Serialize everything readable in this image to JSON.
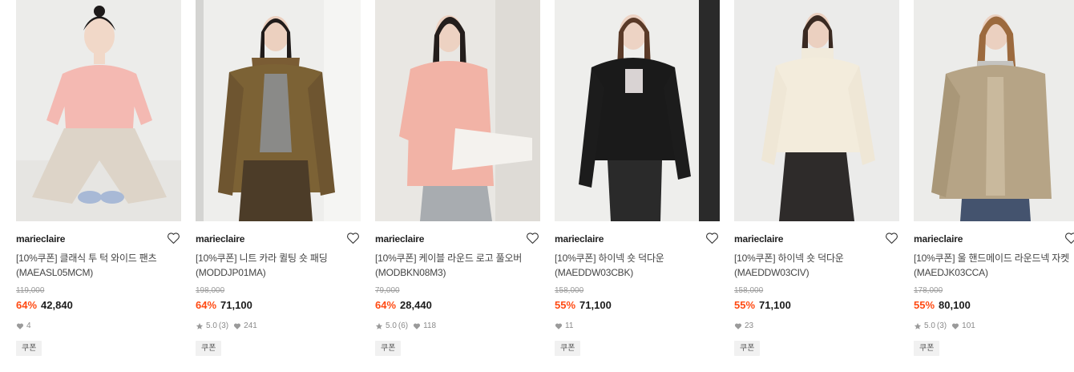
{
  "products": [
    {
      "brand": "marieclaire",
      "name": "[10%쿠폰] 클래식 투 턱 와이드 팬츠 (MAEASL05MCM)",
      "original_price": "119,000",
      "discount": "64%",
      "price": "42,840",
      "rating": "",
      "review_count": "",
      "likes": "4",
      "badge": "쿠폰",
      "image": "model-pink-knit-wide-pants"
    },
    {
      "brand": "marieclaire",
      "name": "[10%쿠폰] 니트 카라 퀼팅 숏 패딩 (MODDJP01MA)",
      "original_price": "198,000",
      "discount": "64%",
      "price": "71,100",
      "rating": "5.0",
      "review_count": "(3)",
      "likes": "241",
      "badge": "쿠폰",
      "image": "model-khaki-quilted-padding"
    },
    {
      "brand": "marieclaire",
      "name": "[10%쿠폰] 케이블 라운드 로고 풀오버 (MODBKN08M3)",
      "original_price": "79,000",
      "discount": "64%",
      "price": "28,440",
      "rating": "5.0",
      "review_count": "(6)",
      "likes": "118",
      "badge": "쿠폰",
      "image": "model-pink-cable-pullover"
    },
    {
      "brand": "marieclaire",
      "name": "[10%쿠폰] 하이넥 숏 덕다운 (MAEDDW03CBK)",
      "original_price": "158,000",
      "discount": "55%",
      "price": "71,100",
      "rating": "",
      "review_count": "",
      "likes": "11",
      "badge": "쿠폰",
      "image": "model-black-short-down"
    },
    {
      "brand": "marieclaire",
      "name": "[10%쿠폰] 하이넥 숏 덕다운 (MAEDDW03CIV)",
      "original_price": "158,000",
      "discount": "55%",
      "price": "71,100",
      "rating": "",
      "review_count": "",
      "likes": "23",
      "badge": "쿠폰",
      "image": "model-ivory-short-down"
    },
    {
      "brand": "marieclaire",
      "name": "[10%쿠폰] 울 핸드메이드 라운드넥 자켓(MAEDJK03CCA)",
      "original_price": "178,000",
      "discount": "55%",
      "price": "80,100",
      "rating": "5.0",
      "review_count": "(3)",
      "likes": "101",
      "badge": "쿠폰",
      "image": "model-beige-wool-jacket"
    }
  ],
  "icons": {
    "wishlist": "heart-outline-icon",
    "like": "heart-filled-icon",
    "rating": "star-icon"
  },
  "colors": {
    "discount": "#ff4a12",
    "price": "#1c1c1c",
    "original_price": "#9a9a9a",
    "meta": "#8a8a8a",
    "badge_bg": "#f1f1f1"
  }
}
